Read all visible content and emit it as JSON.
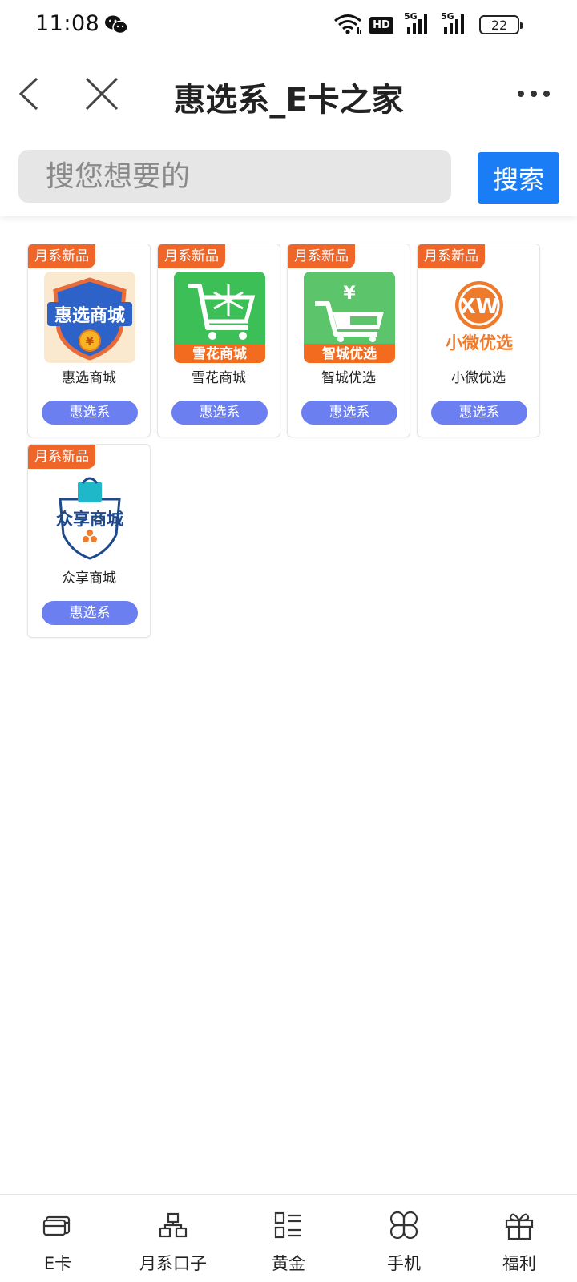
{
  "status": {
    "time": "11:08",
    "network_label": "HD",
    "signal_1": "5G",
    "signal_2": "5G",
    "battery": "22"
  },
  "header": {
    "title": "惠选系_E卡之家"
  },
  "search": {
    "placeholder": "搜您想要的",
    "button_label": "搜索"
  },
  "products": [
    {
      "badge": "月系新品",
      "name": "惠选商城",
      "tag": "惠选系",
      "logo_text": "惠选商城"
    },
    {
      "badge": "月系新品",
      "name": "雪花商城",
      "tag": "惠选系",
      "logo_text": "雪花商城"
    },
    {
      "badge": "月系新品",
      "name": "智城优选",
      "tag": "惠选系",
      "logo_text": "智城优选"
    },
    {
      "badge": "月系新品",
      "name": "小微优选",
      "tag": "惠选系",
      "logo_text": "小微优选"
    },
    {
      "badge": "月系新品",
      "name": "众享商城",
      "tag": "惠选系",
      "logo_text": "众享商城"
    }
  ],
  "bottom_nav": [
    {
      "label": "E卡",
      "icon": "card-icon"
    },
    {
      "label": "月系口子",
      "icon": "org-icon"
    },
    {
      "label": "黄金",
      "icon": "list-icon"
    },
    {
      "label": "手机",
      "icon": "clover-icon"
    },
    {
      "label": "福利",
      "icon": "gift-icon"
    }
  ],
  "colors": {
    "badge": "#f06628",
    "tag": "#6b7ff0",
    "search_button": "#1a7df5"
  }
}
